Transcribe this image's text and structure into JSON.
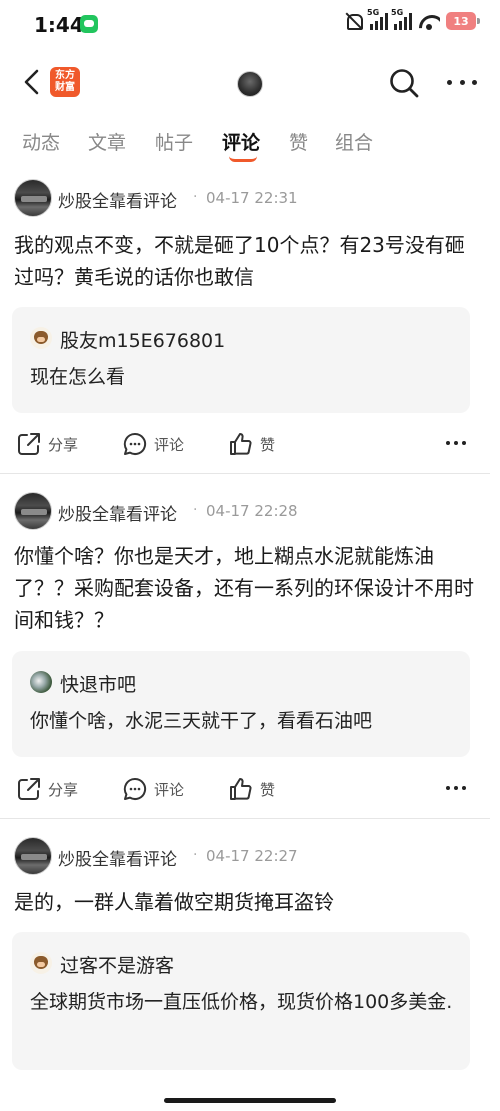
{
  "status_bar": {
    "time": "1:44",
    "signal1_label": "5G",
    "signal2_label": "5G",
    "battery": "13"
  },
  "header": {
    "logo_text": "东方财富"
  },
  "tabs": [
    {
      "label": "动态"
    },
    {
      "label": "文章"
    },
    {
      "label": "帖子"
    },
    {
      "label": "评论"
    },
    {
      "label": "赞"
    },
    {
      "label": "组合"
    }
  ],
  "active_tab_index": 3,
  "actions": {
    "share": "分享",
    "comment": "评论",
    "like": "赞"
  },
  "posts": [
    {
      "author": "炒股全靠看评论",
      "dot": "·",
      "time": "04-17 22:31",
      "text": "我的观点不变，不就是砸了10个点？有23号没有砸过吗？黄毛说的话你也敢信",
      "quote": {
        "name": "股友m15E676801",
        "text": "现在怎么看"
      }
    },
    {
      "author": "炒股全靠看评论",
      "dot": "·",
      "time": "04-17 22:28",
      "text": "你懂个啥？你也是天才，地上糊点水泥就能炼油了？？采购配套设备，还有一系列的环保设计不用时间和钱？？",
      "quote": {
        "name": "快退市吧",
        "text": "你懂个啥，水泥三天就干了，看看石油吧"
      }
    },
    {
      "author": "炒股全靠看评论",
      "dot": "·",
      "time": "04-17 22:27",
      "text": "是的，一群人靠着做空期货掩耳盗铃",
      "quote": {
        "name": "过客不是游客",
        "text": "全球期货市场一直压低价格，现货价格100多美金."
      }
    }
  ]
}
